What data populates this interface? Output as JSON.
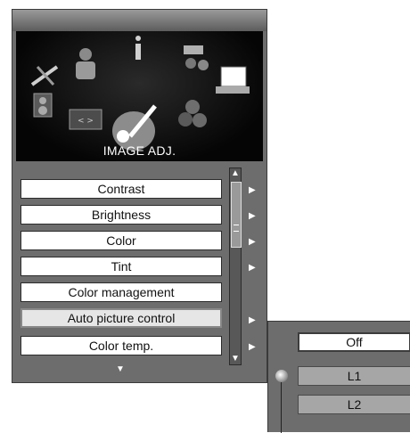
{
  "banner": {
    "title": "IMAGE ADJ."
  },
  "menu": {
    "items": [
      {
        "label": "Contrast"
      },
      {
        "label": "Brightness"
      },
      {
        "label": "Color"
      },
      {
        "label": "Tint"
      },
      {
        "label": "Color management"
      },
      {
        "label": "Auto picture control",
        "selected": true
      },
      {
        "label": "Color temp."
      }
    ]
  },
  "submenu": {
    "options": [
      {
        "label": "Off",
        "active": true
      },
      {
        "label": "L1"
      },
      {
        "label": "L2"
      }
    ]
  },
  "icons": {
    "arrow_right": "▶",
    "scroll_up": "▲",
    "scroll_down": "▼",
    "more_down": "▼"
  }
}
